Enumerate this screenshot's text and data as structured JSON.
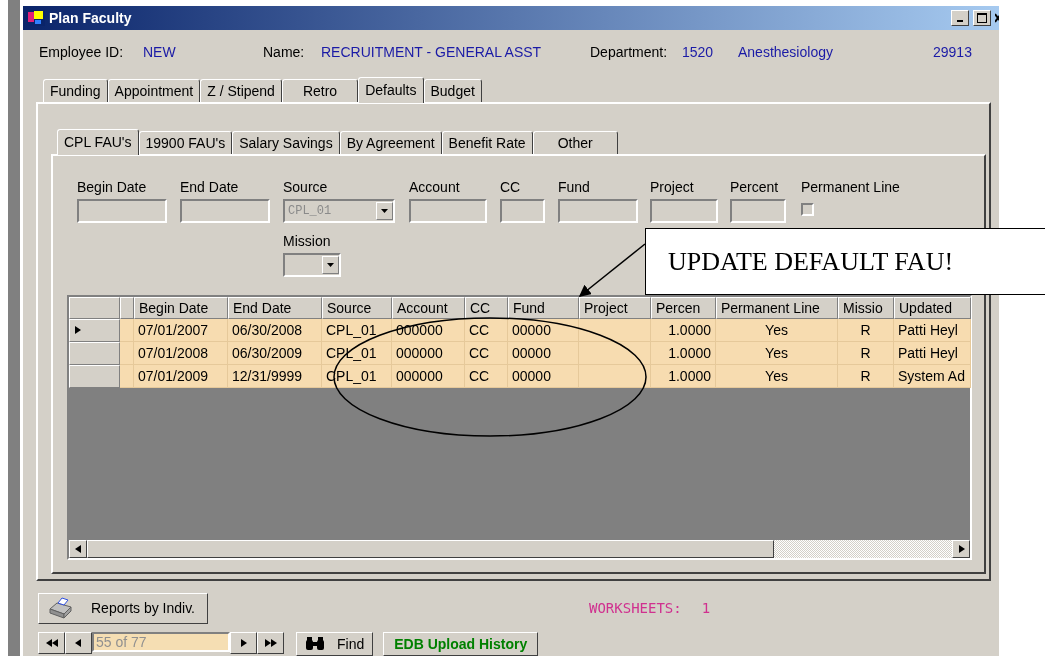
{
  "window": {
    "title": "Plan Faculty"
  },
  "header": {
    "employee_id_label": "Employee ID:",
    "employee_id": "NEW",
    "name_label": "Name:",
    "name": "RECRUITMENT - GENERAL ASST",
    "department_label": "Department:",
    "department_code": "1520",
    "department_name": "Anesthesiology",
    "record_number": "29913"
  },
  "tabs": [
    {
      "label": "Funding",
      "selected": false
    },
    {
      "label": "Appointment",
      "selected": false
    },
    {
      "label": "Z / Stipend",
      "selected": false
    },
    {
      "label": "Retro",
      "selected": false
    },
    {
      "label": "Defaults",
      "selected": true
    },
    {
      "label": "Budget",
      "selected": false
    }
  ],
  "subtabs": [
    {
      "label": "CPL FAU's",
      "selected": true
    },
    {
      "label": "19900 FAU's",
      "selected": false
    },
    {
      "label": "Salary Savings",
      "selected": false
    },
    {
      "label": "By Agreement",
      "selected": false
    },
    {
      "label": "Benefit Rate",
      "selected": false
    },
    {
      "label": "Other",
      "selected": false
    }
  ],
  "fields": [
    {
      "label": "Begin Date",
      "kind": "text",
      "disabled": true
    },
    {
      "label": "End Date",
      "kind": "text",
      "disabled": true
    },
    {
      "label": "Source",
      "kind": "combo",
      "value": "CPL_01",
      "disabled": true
    },
    {
      "label": "Account",
      "kind": "text",
      "disabled": true
    },
    {
      "label": "CC",
      "kind": "text",
      "disabled": true
    },
    {
      "label": "Fund",
      "kind": "text",
      "disabled": true
    },
    {
      "label": "Project",
      "kind": "text",
      "disabled": true
    },
    {
      "label": "Percent",
      "kind": "text",
      "disabled": true
    },
    {
      "label": "Permanent Line",
      "kind": "check",
      "checked": false
    }
  ],
  "mission": {
    "label": "Mission",
    "kind": "combo",
    "disabled": true
  },
  "grid": {
    "columns": [
      "Begin Date",
      "End Date",
      "Source",
      "Account",
      "CC",
      "Fund",
      "Project",
      "Percen",
      "Permanent Line",
      "Missio",
      "Updated"
    ],
    "rows": [
      {
        "current": true,
        "cells": [
          "07/01/2007",
          "06/30/2008",
          "CPL_01",
          "000000",
          "CC",
          "00000",
          null,
          "1.0000",
          "Yes",
          "R",
          "Patti Heyl"
        ]
      },
      {
        "current": false,
        "cells": [
          "07/01/2008",
          "06/30/2009",
          "CPL_01",
          "000000",
          "CC",
          "00000",
          null,
          "1.0000",
          "Yes",
          "R",
          "Patti Heyl"
        ]
      },
      {
        "current": false,
        "cells": [
          "07/01/2009",
          "12/31/9999",
          "CPL_01",
          "000000",
          "CC",
          "00000",
          null,
          "1.0000",
          "Yes",
          "R",
          "System Ad"
        ]
      }
    ]
  },
  "reports_button": "Reports by Indiv.",
  "worksheets": {
    "label": "WORKSHEETS:",
    "count": "1"
  },
  "navigator": {
    "position": "55 of 77"
  },
  "find_button": "Find",
  "upload_button": "EDB Upload History",
  "annotation": {
    "text": "UPDATE DEFAULT FAU!"
  }
}
